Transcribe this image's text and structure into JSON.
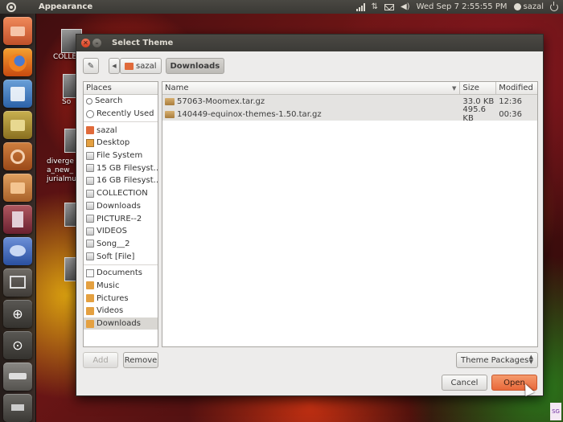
{
  "top_panel": {
    "app_title": "Appearance",
    "datetime": "Wed Sep  7  2:55:55 PM",
    "user": "sazal"
  },
  "desktop": {
    "labels": [
      "COLLE",
      "So",
      "diverge",
      "a_new_",
      "jurialmu"
    ]
  },
  "dialog": {
    "title": "Select Theme",
    "breadcrumbs": [
      "sazal",
      "Downloads"
    ],
    "places": {
      "header": "Places",
      "group1": [
        "Search",
        "Recently Used"
      ],
      "group2": [
        "sazal",
        "Desktop",
        "File System",
        "15 GB Filesyst...",
        "16 GB Filesyst...",
        "COLLECTION",
        "Downloads",
        "PICTURE--2",
        "VIDEOS",
        "Song__2",
        "Soft [File]"
      ],
      "group3": [
        "Documents",
        "Music",
        "Pictures",
        "Videos",
        "Downloads"
      ]
    },
    "files": {
      "columns": {
        "name": "Name",
        "size": "Size",
        "modified": "Modified"
      },
      "rows": [
        {
          "name": "57063-Moomex.tar.gz",
          "size": "33.0 KB",
          "modified": "12:36"
        },
        {
          "name": "140449-equinox-themes-1.50.tar.gz",
          "size": "495.6 KB",
          "modified": "00:36"
        }
      ]
    },
    "buttons": {
      "add": "Add",
      "remove": "Remove",
      "filter": "Theme Packages",
      "cancel": "Cancel",
      "open": "Open"
    }
  },
  "corner_logo": "SG"
}
